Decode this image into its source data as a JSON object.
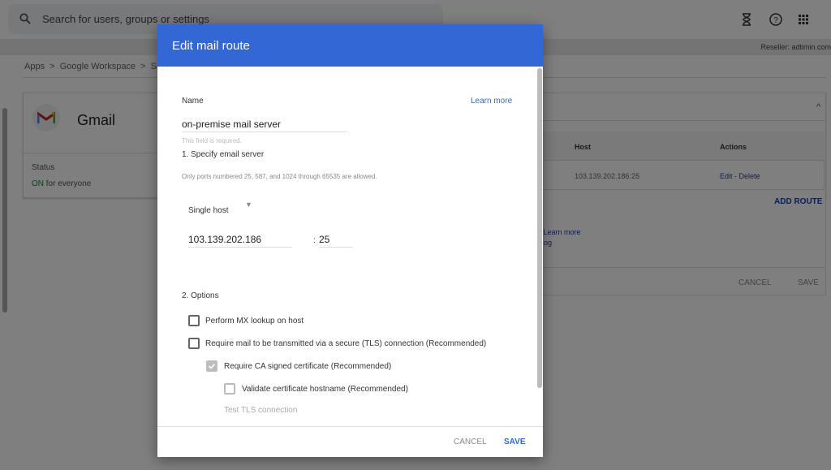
{
  "topbar": {
    "search_placeholder": "Search for users, groups or settings",
    "icons": [
      "hourglass-icon",
      "help-icon",
      "apps-grid-icon"
    ],
    "reseller": "Reseller: adtimin.com"
  },
  "breadcrumb": "Apps  >  Google Workspace  >  Set",
  "app_card": {
    "name": "Gmail",
    "status_label": "Status",
    "status_value": "ON",
    "status_suffix": " for everyone"
  },
  "routes_table": {
    "headers": [
      "Host",
      "Actions"
    ],
    "rows": [
      {
        "host": "103.139.202.186:25",
        "actions": "Edit - Delete"
      }
    ],
    "add_route": "ADD ROUTE",
    "learn_more_fragment": "s. Learn more",
    "fragment2": "og",
    "cancel": "CANCEL",
    "save": "SAVE"
  },
  "dialog": {
    "title": "Edit mail route",
    "name_label": "Name",
    "learn_more": "Learn more",
    "name_value": "on-premise mail server",
    "name_hint": "This field is required.",
    "section1": "1. Specify email server",
    "ports_note": "Only ports numbered 25, 587, and 1024 through 65535 are allowed.",
    "host_type": "Single host",
    "host_value": "103.139.202.186",
    "port_sep": ":",
    "port_value": "25",
    "section2": "2. Options",
    "options": [
      {
        "label": "Perform MX lookup on host",
        "checked": false,
        "disabled": false
      },
      {
        "label": "Require mail to be transmitted via a secure (TLS) connection (Recommended)",
        "checked": false,
        "disabled": false
      },
      {
        "label": "Require CA signed certificate (Recommended)",
        "checked": true,
        "disabled": true
      },
      {
        "label": "Validate certificate hostname (Recommended)",
        "checked": false,
        "disabled": true
      }
    ],
    "test_tls": "Test TLS connection",
    "cancel": "CANCEL",
    "save": "SAVE"
  },
  "colors": {
    "accent": "#3367d6",
    "on_status": "#188038",
    "link": "#1a3ba8"
  }
}
